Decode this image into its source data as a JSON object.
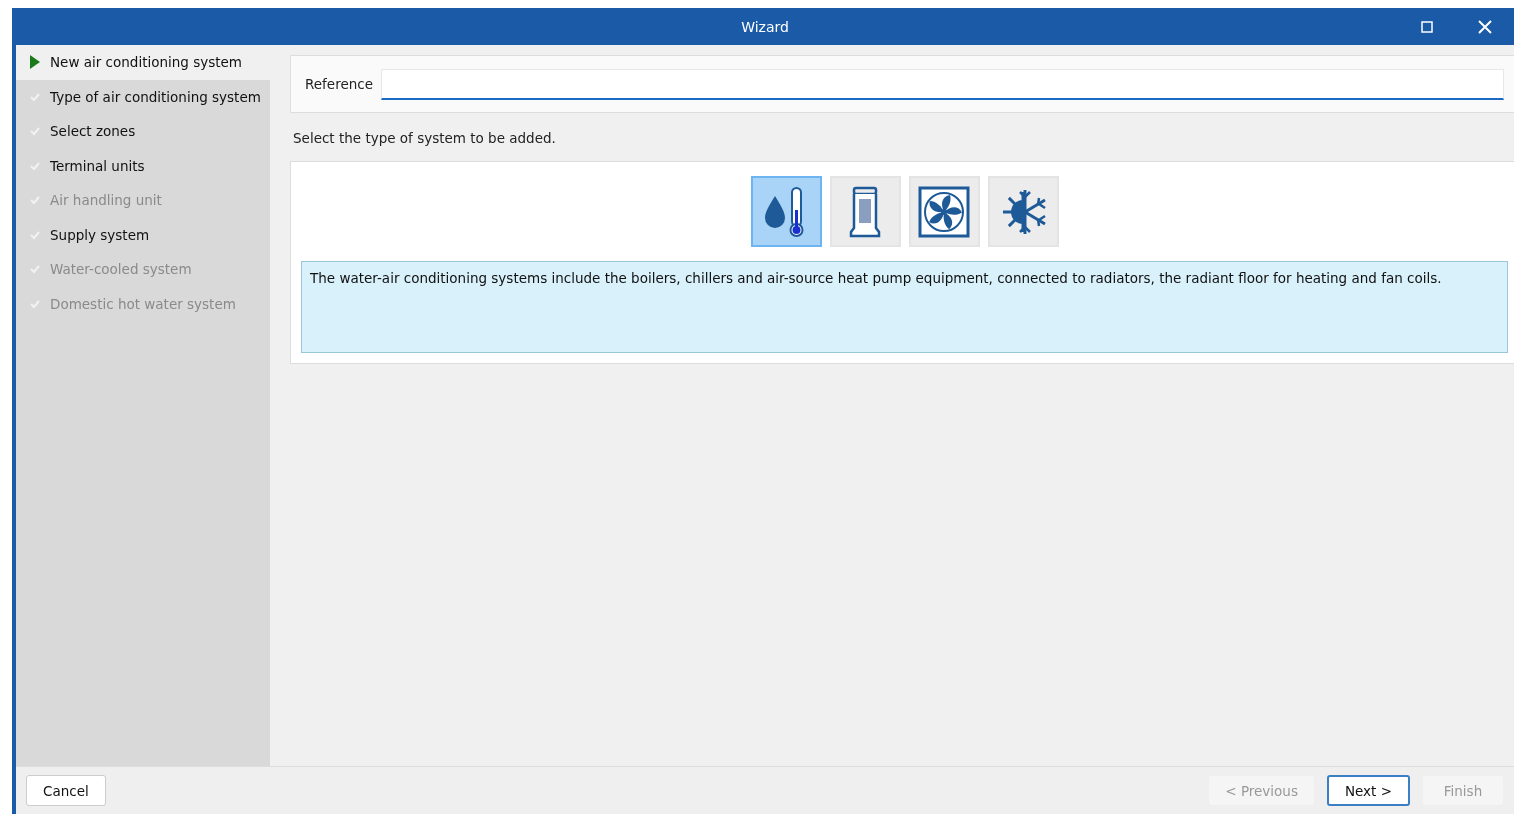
{
  "window": {
    "title": "Wizard"
  },
  "steps": [
    {
      "label": "New air conditioning system",
      "selected": true,
      "disabled": false
    },
    {
      "label": "Type of air conditioning system",
      "selected": false,
      "disabled": false
    },
    {
      "label": "Select zones",
      "selected": false,
      "disabled": false
    },
    {
      "label": "Terminal units",
      "selected": false,
      "disabled": false
    },
    {
      "label": "Air handling unit",
      "selected": false,
      "disabled": true
    },
    {
      "label": "Supply system",
      "selected": false,
      "disabled": false
    },
    {
      "label": "Water-cooled system",
      "selected": false,
      "disabled": true
    },
    {
      "label": "Domestic hot water system",
      "selected": false,
      "disabled": true
    }
  ],
  "reference": {
    "label": "Reference"
  },
  "prompt": "Select the type of system to be added.",
  "system_types": [
    {
      "kind": "water",
      "selected": true
    },
    {
      "kind": "unit",
      "selected": false
    },
    {
      "kind": "fan",
      "selected": false
    },
    {
      "kind": "heatcool",
      "selected": false
    }
  ],
  "description": "The water-air conditioning systems include the boilers, chillers and air-source heat pump equipment, connected to radiators, the radiant floor for heating and fan coils.",
  "buttons": [
    {
      "label": "Cancel",
      "kind": "cancel",
      "disabled": false
    },
    {
      "label": "< Previous",
      "kind": "nav",
      "disabled": true
    },
    {
      "label": "Next >",
      "kind": "default",
      "disabled": false
    },
    {
      "label": "Finish",
      "kind": "nav",
      "disabled": true
    }
  ]
}
